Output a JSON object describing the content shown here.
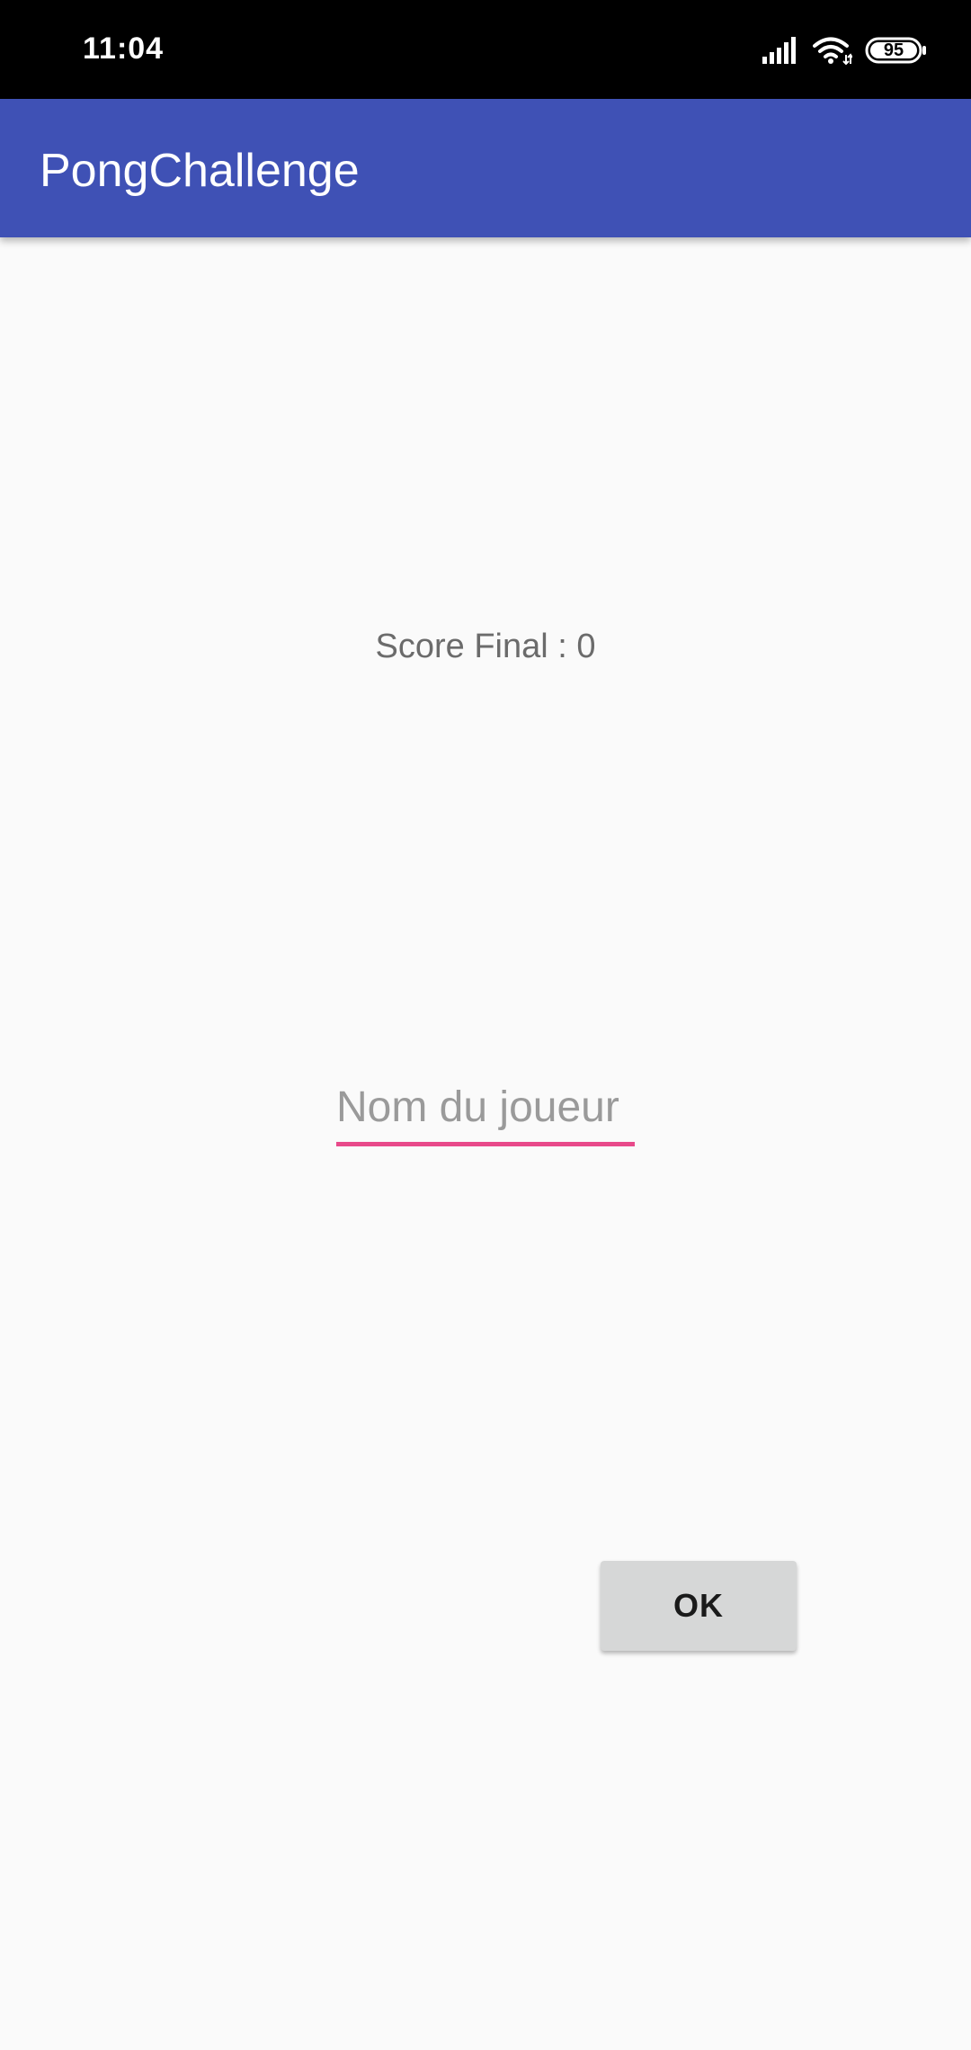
{
  "status_bar": {
    "time": "11:04",
    "battery_level": "95",
    "icons": [
      "signal-icon",
      "wifi-icon",
      "battery-icon"
    ],
    "background_color": "#000000"
  },
  "app_bar": {
    "title": "PongChallenge",
    "color": "#3f51b5"
  },
  "main": {
    "score_text": "Score Final : 0",
    "name_input": {
      "placeholder": "Nom du joueur",
      "value": "",
      "underline_color": "#e84a8a"
    },
    "ok_button_label": "OK"
  }
}
